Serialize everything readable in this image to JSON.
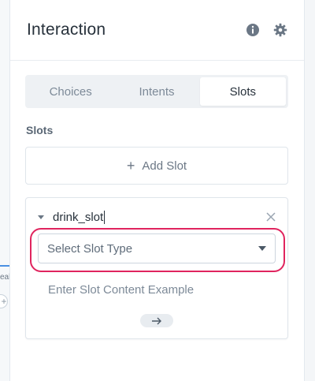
{
  "canvas": {
    "fragment_text": "eak",
    "add_symbol": "+"
  },
  "panel": {
    "title": "Interaction",
    "info_icon": "info-icon",
    "settings_icon": "gear-icon"
  },
  "tabs": [
    {
      "label": "Choices",
      "active": false
    },
    {
      "label": "Intents",
      "active": false
    },
    {
      "label": "Slots",
      "active": true
    }
  ],
  "slots": {
    "section_label": "Slots",
    "add_label": "Add Slot",
    "add_symbol": "+",
    "items": [
      {
        "name": "drink_slot",
        "type_placeholder": "Select Slot Type",
        "example_placeholder": "Enter Slot Content Example"
      }
    ]
  },
  "colors": {
    "highlight": "#e0245e",
    "text_dark": "#27313b",
    "muted": "#7d8a98"
  }
}
